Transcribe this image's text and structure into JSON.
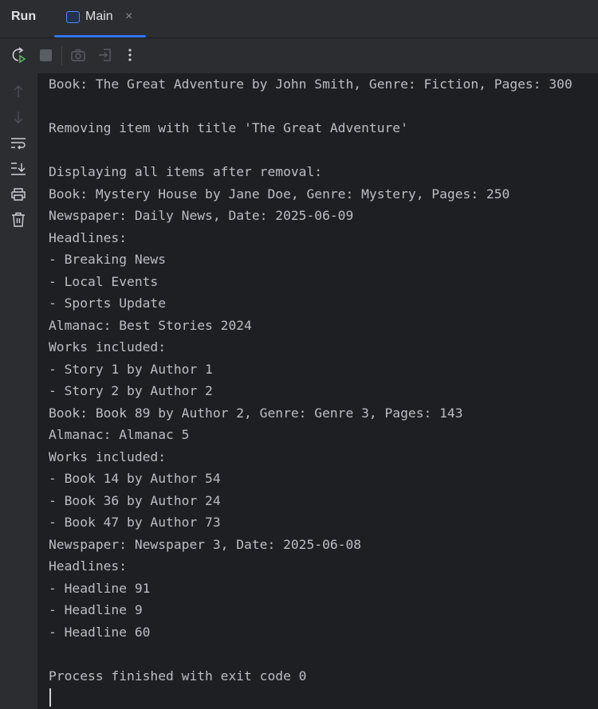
{
  "tabbar": {
    "run_label": "Run",
    "tab_label": "Main",
    "close_glyph": "×"
  },
  "toolbar": {
    "buttons": [
      "rerun-icon",
      "stop-icon",
      "camera-icon",
      "exit-icon",
      "more-icon"
    ]
  },
  "console": {
    "lines": [
      "Book: The Great Adventure by John Smith, Genre: Fiction, Pages: 300",
      "",
      "Removing item with title 'The Great Adventure'",
      "",
      "Displaying all items after removal:",
      "Book: Mystery House by Jane Doe, Genre: Mystery, Pages: 250",
      "Newspaper: Daily News, Date: 2025-06-09",
      "Headlines:",
      "- Breaking News",
      "- Local Events",
      "- Sports Update",
      "Almanac: Best Stories 2024",
      "Works included:",
      "- Story 1 by Author 1",
      "- Story 2 by Author 2",
      "Book: Book 89 by Author 2, Genre: Genre 3, Pages: 143",
      "Almanac: Almanac 5",
      "Works included:",
      "- Book 14 by Author 54",
      "- Book 36 by Author 24",
      "- Book 47 by Author 73",
      "Newspaper: Newspaper 3, Date: 2025-06-08",
      "Headlines:",
      "- Headline 91",
      "- Headline 9",
      "- Headline 60",
      "",
      "Process finished with exit code 0"
    ]
  }
}
